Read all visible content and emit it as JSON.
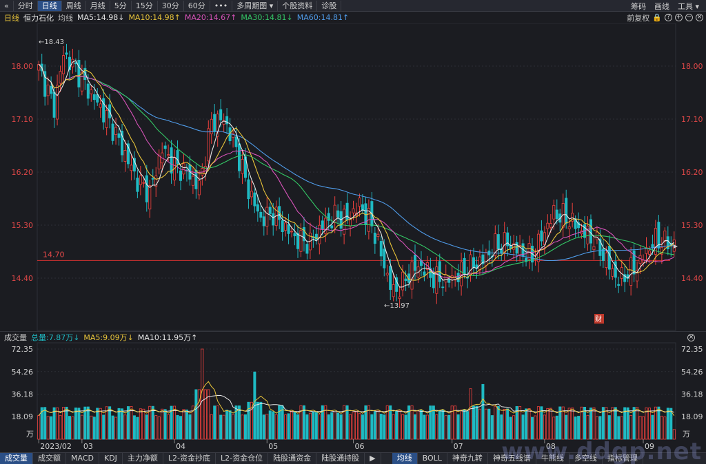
{
  "toolbar": {
    "back_icon": "«",
    "tabs": [
      {
        "label": "分时"
      },
      {
        "label": "日线",
        "active": true
      },
      {
        "label": "周线"
      },
      {
        "label": "月线"
      },
      {
        "label": "5分"
      },
      {
        "label": "15分"
      },
      {
        "label": "30分"
      },
      {
        "label": "60分"
      },
      {
        "label": "•••"
      },
      {
        "label": "多周期图 ▾"
      },
      {
        "label": "个股资料"
      },
      {
        "label": "诊股"
      }
    ],
    "right": {
      "chips": "筹码",
      "draw": "画线",
      "tools": "工具 ▾"
    }
  },
  "info": {
    "period": "日线",
    "name": "恒力石化",
    "ma_label": "均线",
    "ma": [
      {
        "text": "MA5:14.98↓",
        "color": "#e6e6e6"
      },
      {
        "text": "MA10:14.98↑",
        "color": "#e8c43a"
      },
      {
        "text": "MA20:14.67↑",
        "color": "#d653b8"
      },
      {
        "text": "MA30:14.81↓",
        "color": "#34c866"
      },
      {
        "text": "MA60:14.81↑",
        "color": "#4f9be8"
      }
    ],
    "fq": "前复权"
  },
  "price_axis": {
    "ticks": [
      {
        "label": "18.00",
        "v": 18.0
      },
      {
        "label": "17.10",
        "v": 17.1
      },
      {
        "label": "16.20",
        "v": 16.2
      },
      {
        "label": "15.30",
        "v": 15.3
      },
      {
        "label": "14.40",
        "v": 14.4
      }
    ]
  },
  "annotations": {
    "high": "←18.43",
    "low": "←13.97",
    "hline": "14.70",
    "hline_value": 14.7,
    "badge": "财"
  },
  "volume": {
    "title": "成交量",
    "total": "总量:7.87万↓",
    "ma5": "MA5:9.09万↓",
    "ma10": "MA10:11.95万↑",
    "ticks": [
      {
        "label": "72.35",
        "v": 72.35
      },
      {
        "label": "54.26",
        "v": 54.26
      },
      {
        "label": "36.18",
        "v": 36.18
      },
      {
        "label": "18.09",
        "v": 18.09
      }
    ],
    "unit": "万"
  },
  "date_axis": [
    "2023/02",
    "03",
    "04",
    "05",
    "06",
    "07",
    "08",
    "09"
  ],
  "bottom_tabs": [
    {
      "label": "成交量",
      "active": true
    },
    {
      "label": "成交额"
    },
    {
      "label": "MACD"
    },
    {
      "label": "KDJ"
    },
    {
      "label": "主力净额"
    },
    {
      "label": "L2-资金抄底"
    },
    {
      "label": "L2-资金仓位"
    },
    {
      "label": "陆股通资金"
    },
    {
      "label": "陆股通持股"
    },
    {
      "label": "▶"
    },
    {
      "label": "均线",
      "active": true
    },
    {
      "label": "BOLL"
    },
    {
      "label": "神奇九转"
    },
    {
      "label": "神奇五线谱"
    },
    {
      "label": "牛熊线"
    },
    {
      "label": "多空线"
    },
    {
      "label": "指标管理"
    }
  ],
  "watermark": "www.ddgp.net",
  "colors": {
    "up": "#f0413d",
    "down": "#1fbac3",
    "ma5": "#e6e6e6",
    "ma10": "#e8c43a",
    "ma20": "#d653b8",
    "ma30": "#34c866",
    "ma60": "#4f9be8"
  },
  "chart_data": {
    "type": "candlestick",
    "anchors_close": [
      [
        0,
        17.95
      ],
      [
        2,
        17.7
      ],
      [
        5,
        17.3
      ],
      [
        8,
        18.2
      ],
      [
        12,
        17.95
      ],
      [
        16,
        17.6
      ],
      [
        20,
        17.3
      ],
      [
        24,
        16.95
      ],
      [
        28,
        16.5
      ],
      [
        32,
        16.05
      ],
      [
        36,
        15.85
      ],
      [
        40,
        16.6
      ],
      [
        44,
        16.3
      ],
      [
        48,
        16.2
      ],
      [
        52,
        15.95
      ],
      [
        56,
        17.05
      ],
      [
        60,
        17.1
      ],
      [
        64,
        16.6
      ],
      [
        68,
        15.9
      ],
      [
        72,
        15.4
      ],
      [
        76,
        15.5
      ],
      [
        80,
        15.25
      ],
      [
        84,
        15.05
      ],
      [
        88,
        15.0
      ],
      [
        92,
        15.3
      ],
      [
        96,
        15.45
      ],
      [
        100,
        15.4
      ],
      [
        104,
        15.65
      ],
      [
        108,
        15.3
      ],
      [
        110,
        15.0
      ],
      [
        112,
        14.6
      ],
      [
        115,
        14.15
      ],
      [
        118,
        14.3
      ],
      [
        121,
        14.55
      ],
      [
        124,
        14.6
      ],
      [
        128,
        14.4
      ],
      [
        132,
        14.35
      ],
      [
        136,
        14.45
      ],
      [
        140,
        14.6
      ],
      [
        144,
        14.7
      ],
      [
        148,
        14.95
      ],
      [
        152,
        15.0
      ],
      [
        156,
        14.85
      ],
      [
        160,
        14.75
      ],
      [
        164,
        15.2
      ],
      [
        167,
        15.5
      ],
      [
        170,
        15.45
      ],
      [
        173,
        15.35
      ],
      [
        176,
        15.2
      ],
      [
        180,
        15.05
      ],
      [
        184,
        14.7
      ],
      [
        188,
        14.35
      ],
      [
        191,
        14.5
      ],
      [
        194,
        14.6
      ],
      [
        197,
        14.85
      ],
      [
        200,
        15.05
      ],
      [
        203,
        15.0
      ],
      [
        206,
        14.98
      ]
    ],
    "high": 18.43,
    "low": 13.97,
    "ma_latest": {
      "MA5": 14.98,
      "MA10": 14.98,
      "MA20": 14.67,
      "MA30": 14.81,
      "MA60": 14.81
    },
    "volume_latest_wan": 7.87,
    "volume_ma_latest_wan": {
      "MA5": 9.09,
      "MA10": 11.95
    },
    "volume_spikes": [
      [
        53,
        72.35
      ],
      [
        70,
        54.0
      ],
      [
        140,
        40.5
      ],
      [
        144,
        44.0
      ]
    ]
  }
}
